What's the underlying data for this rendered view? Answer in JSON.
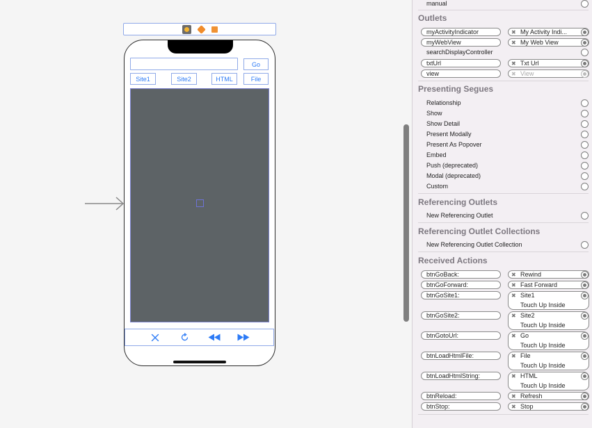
{
  "canvas": {
    "buttons": {
      "go": "Go",
      "site1": "Site1",
      "site2": "Site2",
      "html": "HTML",
      "file": "File"
    },
    "toolbar_icons": [
      "stop-icon",
      "refresh-icon",
      "rewind-icon",
      "fast-forward-icon"
    ],
    "accent_color": "#2d7bf6",
    "webview_color": "#5d6366"
  },
  "inspector": {
    "top_item": "manual",
    "outlets": {
      "title": "Outlets",
      "items": [
        {
          "name": "myActivityIndicator",
          "target": "My Activity Indi..."
        },
        {
          "name": "myWebView",
          "target": "My Web View"
        },
        {
          "name": "searchDisplayController",
          "target": ""
        },
        {
          "name": "txtUrl",
          "target": "Txt Url"
        },
        {
          "name": "view",
          "target": "View"
        }
      ]
    },
    "presenting_segues": {
      "title": "Presenting Segues",
      "items": [
        "Relationship",
        "Show",
        "Show Detail",
        "Present Modally",
        "Present As Popover",
        "Embed",
        "Push (deprecated)",
        "Modal (deprecated)",
        "Custom"
      ]
    },
    "referencing_outlets": {
      "title": "Referencing Outlets",
      "items": [
        "New Referencing Outlet"
      ]
    },
    "referencing_outlet_collections": {
      "title": "Referencing Outlet Collections",
      "items": [
        "New Referencing Outlet Collection"
      ]
    },
    "received_actions": {
      "title": "Received Actions",
      "items": [
        {
          "name": "btnGoBack:",
          "target": "Rewind",
          "event": ""
        },
        {
          "name": "btnGoForward:",
          "target": "Fast Forward",
          "event": ""
        },
        {
          "name": "btnGoSite1:",
          "target": "Site1",
          "event": "Touch Up Inside"
        },
        {
          "name": "btnGoSite2:",
          "target": "Site2",
          "event": "Touch Up Inside"
        },
        {
          "name": "btnGotoUrl:",
          "target": "Go",
          "event": "Touch Up Inside"
        },
        {
          "name": "btnLoadHtmlFile:",
          "target": "File",
          "event": "Touch Up Inside"
        },
        {
          "name": "btnLoadHtmlString:",
          "target": "HTML",
          "event": "Touch Up Inside"
        },
        {
          "name": "btnReload:",
          "target": "Refresh",
          "event": ""
        },
        {
          "name": "btnStop:",
          "target": "Stop",
          "event": ""
        }
      ]
    }
  }
}
